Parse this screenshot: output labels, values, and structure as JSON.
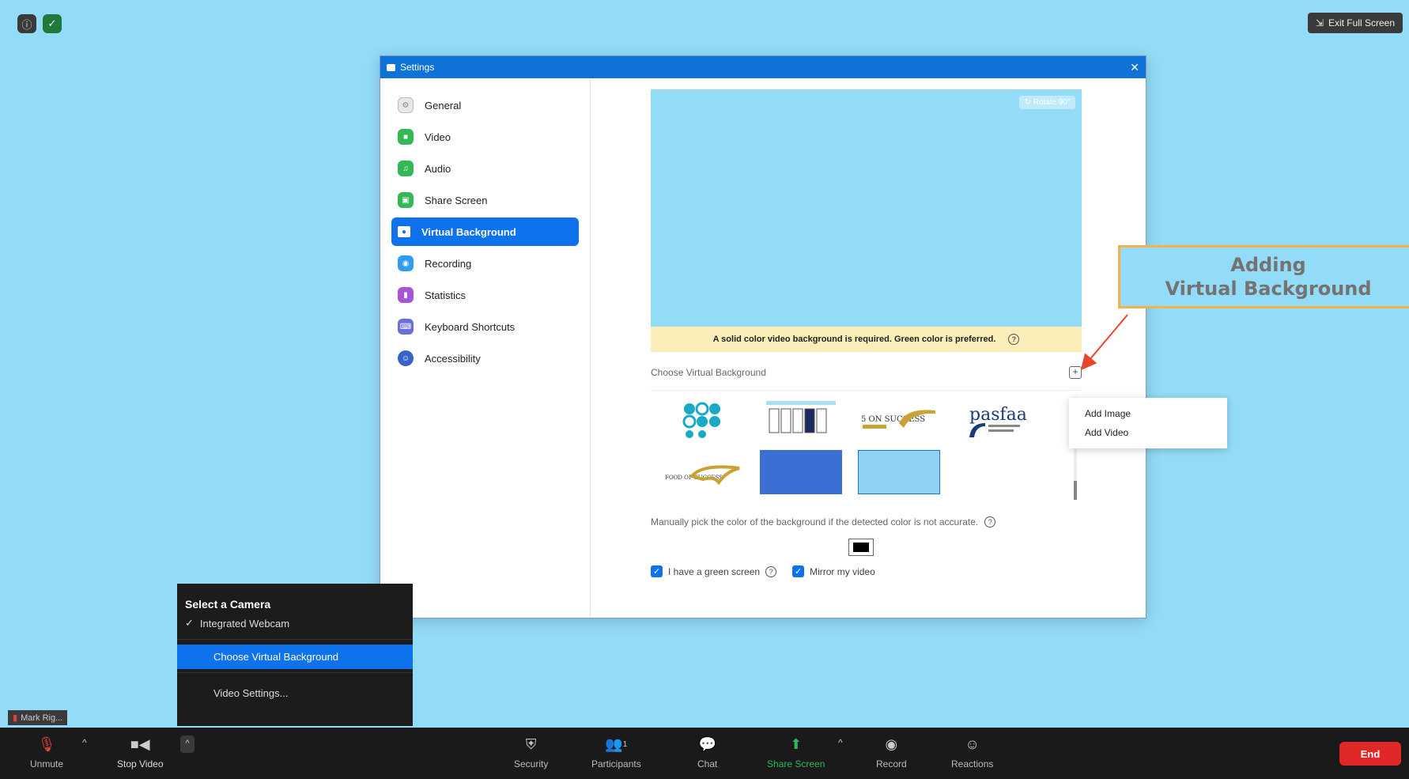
{
  "top": {
    "exit_full_screen": "Exit Full Screen"
  },
  "settings": {
    "title": "Settings",
    "nav": [
      {
        "label": "General",
        "color": "#e8e8e8",
        "icon": "gear-icon"
      },
      {
        "label": "Video",
        "color": "#33b856",
        "icon": "video-icon"
      },
      {
        "label": "Audio",
        "color": "#33b856",
        "icon": "headphones-icon"
      },
      {
        "label": "Share Screen",
        "color": "#33b856",
        "icon": "share-screen-icon"
      },
      {
        "label": "Virtual Background",
        "color": "#0e72ed",
        "icon": "person-icon"
      },
      {
        "label": "Recording",
        "color": "#2e9cf0",
        "icon": "record-icon"
      },
      {
        "label": "Statistics",
        "color": "#a856d9",
        "icon": "chart-icon"
      },
      {
        "label": "Keyboard Shortcuts",
        "color": "#6a70d9",
        "icon": "keyboard-icon"
      },
      {
        "label": "Accessibility",
        "color": "#3864c9",
        "icon": "accessibility-icon"
      }
    ],
    "rotate_label": "Rotate 90°",
    "warning": "A solid color video background is required. Green color is preferred.",
    "choose_label": "Choose Virtual Background",
    "manual_pick": "Manually pick the color of the background if the detected color is not accurate.",
    "green_screen_label": "I have a green screen",
    "mirror_label": "Mirror my video"
  },
  "add_menu": {
    "add_image": "Add Image",
    "add_video": "Add Video"
  },
  "annotation": {
    "line1": "Adding",
    "line2": "Virtual Background"
  },
  "camera_menu": {
    "title": "Select a Camera",
    "camera": "Integrated Webcam",
    "choose_vb": "Choose Virtual Background",
    "video_settings": "Video Settings..."
  },
  "name_tag": "Mark Rig...",
  "bottombar": {
    "unmute": "Unmute",
    "stop_video": "Stop Video",
    "security": "Security",
    "participants": "Participants",
    "participants_count": "1",
    "chat": "Chat",
    "share_screen": "Share Screen",
    "record": "Record",
    "reactions": "Reactions",
    "end": "End"
  },
  "thumbnails": {
    "tile_3_text": "5 ON SUCCESS",
    "tile_4_text": "pasfaa",
    "tile_5_text": "FOOD OF SUCCESS"
  }
}
